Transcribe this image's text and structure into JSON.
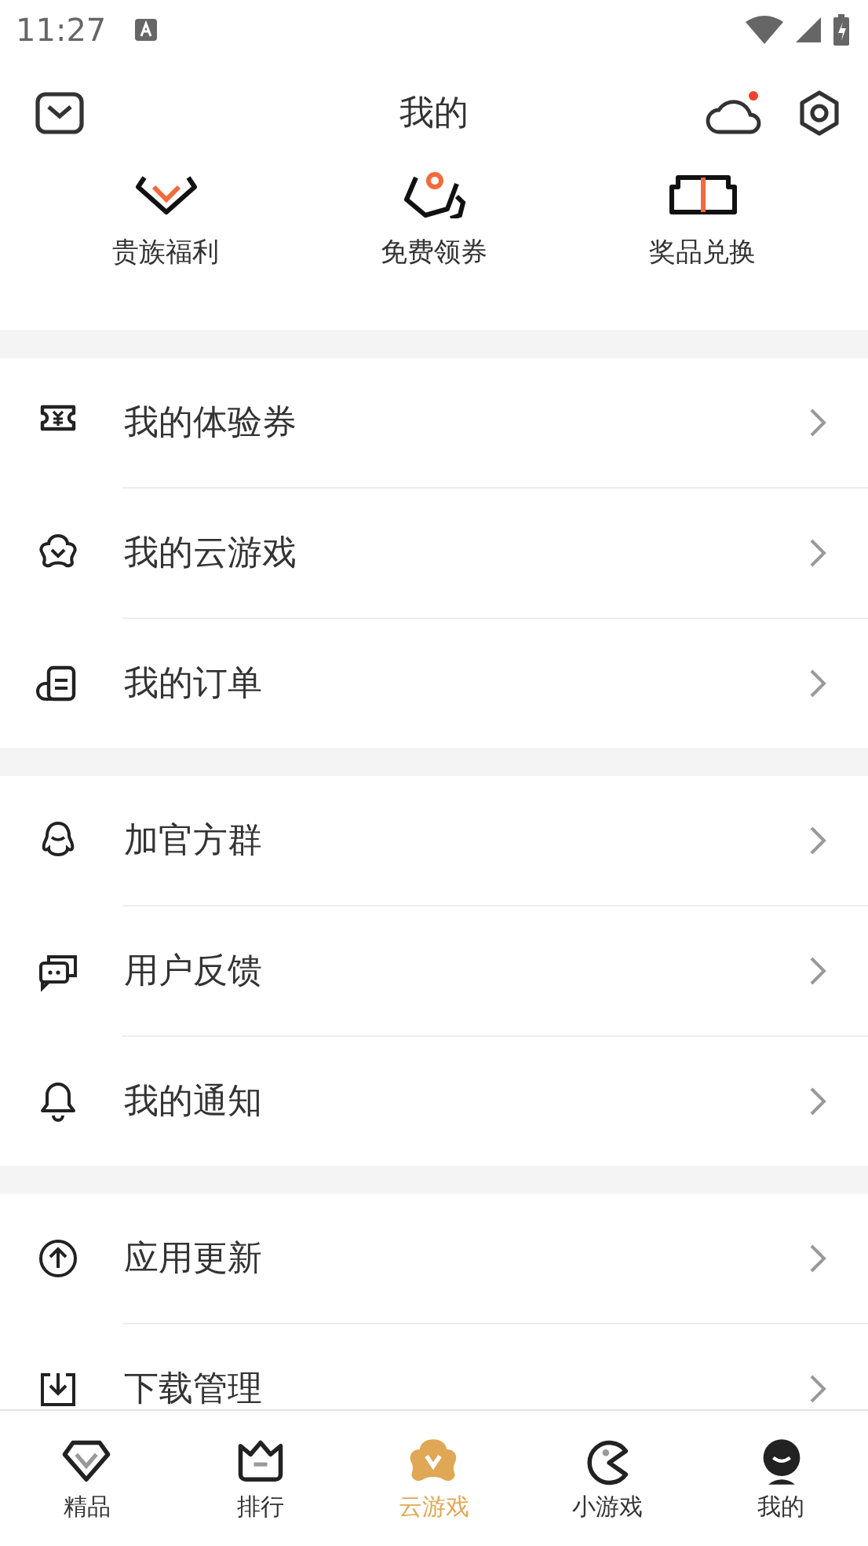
{
  "status_bar": {
    "time": "11:27"
  },
  "header": {
    "title": "我的",
    "notification_dot": true
  },
  "quick_actions": [
    {
      "label": "贵族福利"
    },
    {
      "label": "免费领券"
    },
    {
      "label": "奖品兑换"
    }
  ],
  "menu_groups": [
    [
      {
        "label": "我的体验券"
      },
      {
        "label": "我的云游戏"
      },
      {
        "label": "我的订单"
      }
    ],
    [
      {
        "label": "加官方群"
      },
      {
        "label": "用户反馈"
      },
      {
        "label": "我的通知"
      }
    ],
    [
      {
        "label": "应用更新"
      },
      {
        "label": "下载管理"
      }
    ]
  ],
  "bottom_nav": [
    {
      "label": "精品",
      "selected": false
    },
    {
      "label": "排行",
      "selected": false
    },
    {
      "label": "云游戏",
      "selected": true
    },
    {
      "label": "小游戏",
      "selected": false
    },
    {
      "label": "我的",
      "selected": false
    }
  ]
}
